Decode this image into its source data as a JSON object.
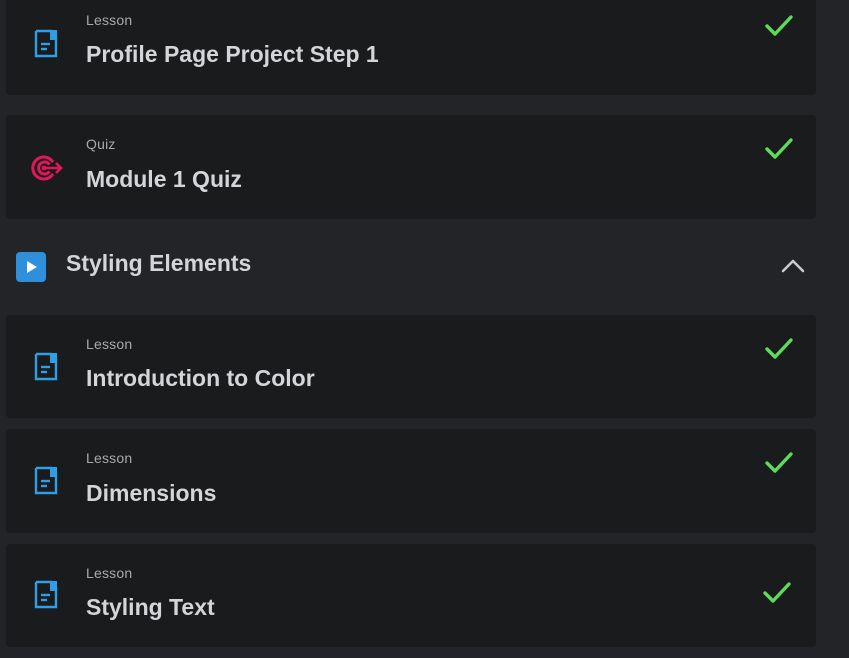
{
  "colors": {
    "page_bg": "#232427",
    "card_bg": "#1a1b1d",
    "lesson_icon": "#2f9ee4",
    "quiz_icon": "#e0185a",
    "check": "#5ddc5b",
    "section_icon": "#2f8fdb"
  },
  "items": [
    {
      "type": "Lesson",
      "title": "Profile Page Project Step 1",
      "icon": "lesson-document-icon",
      "completed": true
    },
    {
      "type": "Quiz",
      "title": "Module 1 Quiz",
      "icon": "quiz-target-icon",
      "completed": true
    }
  ],
  "section": {
    "title": "Styling Elements",
    "icon": "play-icon",
    "toggle_icon": "chevron-up-icon",
    "expanded": true,
    "items": [
      {
        "type": "Lesson",
        "title": "Introduction to Color",
        "icon": "lesson-document-icon",
        "completed": true
      },
      {
        "type": "Lesson",
        "title": "Dimensions",
        "icon": "lesson-document-icon",
        "completed": true
      },
      {
        "type": "Lesson",
        "title": "Styling Text",
        "icon": "lesson-document-icon",
        "completed": true
      }
    ]
  }
}
